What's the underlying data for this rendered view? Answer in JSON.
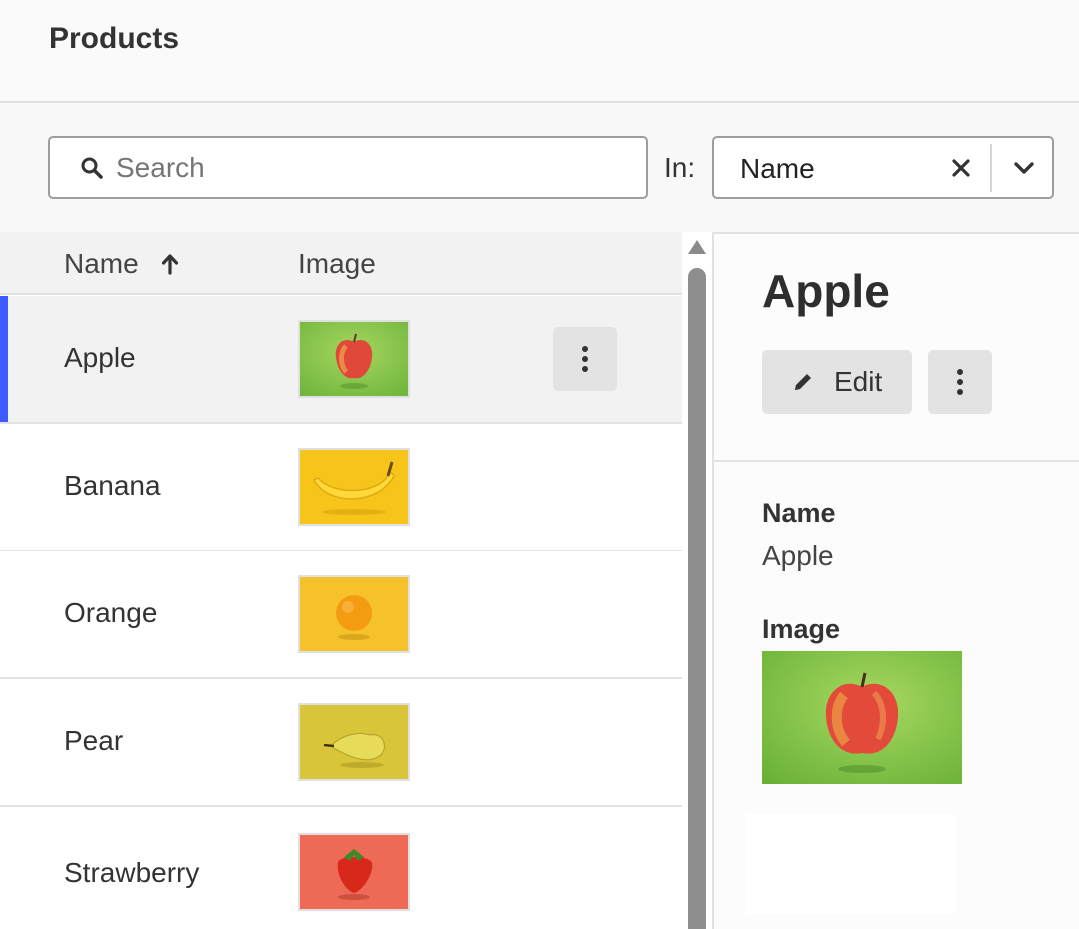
{
  "header": {
    "title": "Products"
  },
  "search": {
    "placeholder": "Search",
    "value": ""
  },
  "filter": {
    "in_label": "In:",
    "selected": "Name"
  },
  "table": {
    "columns": {
      "name": "Name",
      "image": "Image"
    },
    "sort": {
      "column": "Name",
      "direction": "ascending"
    },
    "rows": [
      {
        "name": "Apple",
        "image": "apple-image",
        "selected": true
      },
      {
        "name": "Banana",
        "image": "banana-image",
        "selected": false
      },
      {
        "name": "Orange",
        "image": "orange-image",
        "selected": false
      },
      {
        "name": "Pear",
        "image": "pear-image",
        "selected": false
      },
      {
        "name": "Strawberry",
        "image": "strawberry-image",
        "selected": false
      }
    ]
  },
  "detail": {
    "title": "Apple",
    "edit_label": "Edit",
    "fields": {
      "name_label": "Name",
      "name_value": "Apple",
      "image_label": "Image"
    }
  },
  "colors": {
    "accent": "#3d5afe",
    "apple_bg": "#7cc242",
    "banana_bg": "#f7c51a",
    "orange_bg": "#f6c22b",
    "pear_bg": "#d9c53a",
    "strawberry_bg": "#ee6a57"
  },
  "icons": [
    "search-icon",
    "close-icon",
    "chevron-down-icon",
    "arrow-up-icon",
    "more-vertical-icon",
    "pencil-icon"
  ]
}
